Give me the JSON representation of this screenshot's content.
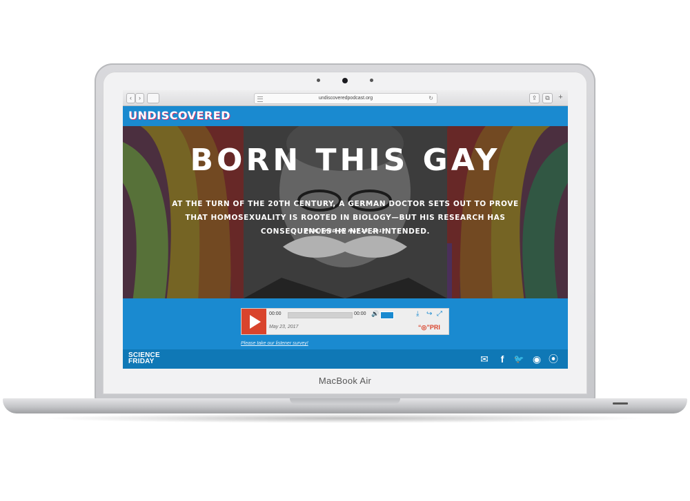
{
  "device": {
    "brand_label": "MacBook Air"
  },
  "browser": {
    "url": "undiscoveredpodcast.org",
    "back_glyph": "‹",
    "forward_glyph": "›",
    "reload_glyph": "↻",
    "share_glyph": "⇪",
    "tabs_glyph": "⧉",
    "newtab_glyph": "+"
  },
  "site": {
    "logo": "UNDISCOVERED",
    "accent_color": "#1a8ad0"
  },
  "hero": {
    "title": "BORN THIS GAY",
    "subtitle": "AT THE TURN OF THE 20TH CENTURY, A GERMAN DOCTOR SETS OUT TO PROVE THAT HOMOSEXUALITY IS ROOTED IN BIOLOGY—BUT HIS RESEARCH HAS CONSEQUENCES HE NEVER INTENDED.",
    "published": "PUBLISHED ON MAY 23, 2017"
  },
  "player": {
    "current_time": "00:00",
    "duration": "00:00",
    "progress": 0,
    "date": "May 23, 2017",
    "network": "PRI",
    "volume_glyph": "🔊",
    "download_glyph": "⤓",
    "share_glyph": "↪",
    "expand_glyph": "⤢"
  },
  "survey_link": "Please take our listener survey!",
  "footer": {
    "logo_line1": "SCIENCE",
    "logo_line2": "FRIDAY",
    "icons": [
      "mail-icon",
      "facebook-icon",
      "twitter-icon",
      "podcast-icon",
      "rss-icon"
    ],
    "mail_glyph": "✉",
    "facebook_glyph": "f",
    "twitter_glyph": "🐦",
    "podcast_glyph": "◉",
    "rss_glyph": "⦿"
  }
}
